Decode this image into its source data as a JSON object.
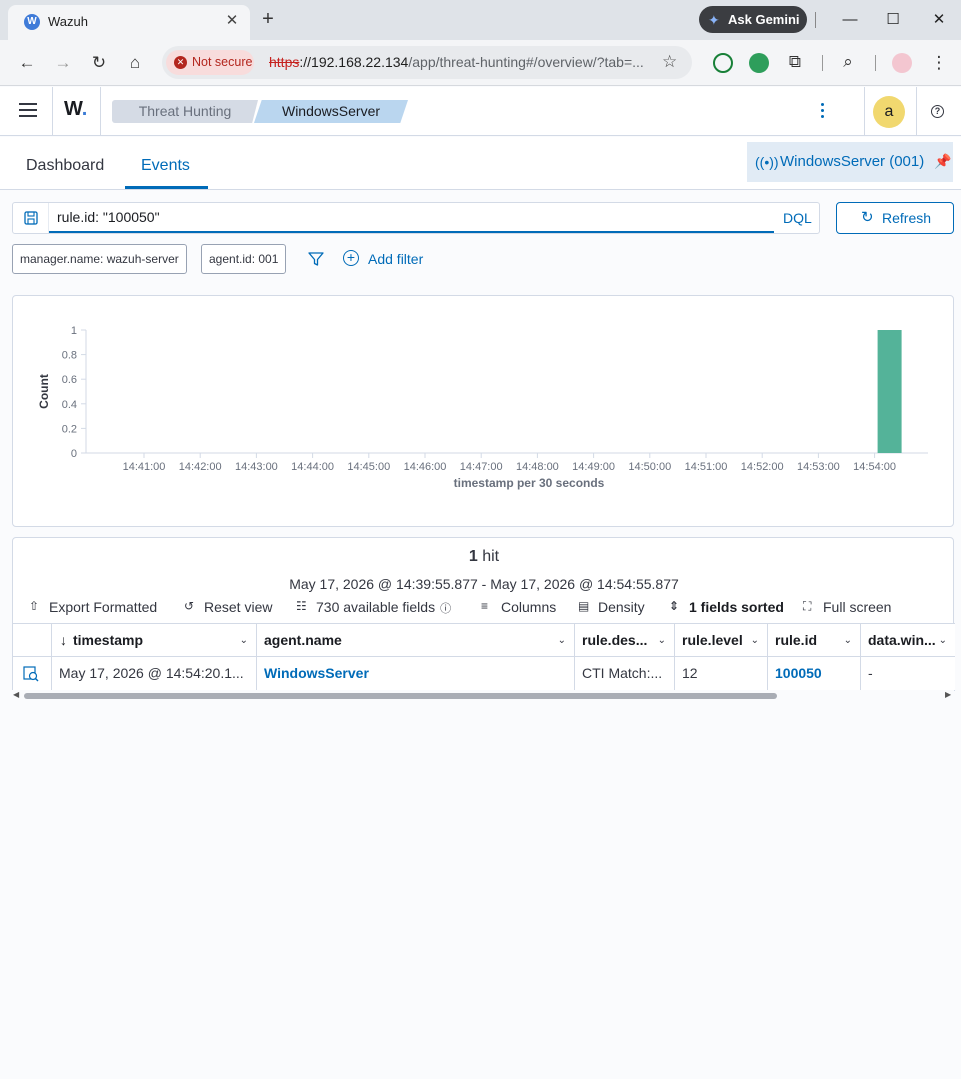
{
  "browser": {
    "tab_title": "Wazuh",
    "tab_favicon": "W",
    "gemini_label": "Ask Gemini",
    "security_label": "Not secure",
    "url_proto": "https",
    "url_host": "://192.168.22.134",
    "url_path": "/app/threat-hunting#/overview/?tab=..."
  },
  "header": {
    "logo": "W",
    "breadcrumbs": [
      "Threat Hunting",
      "WindowsServer"
    ],
    "avatar_initial": "a",
    "help_glyph": "?"
  },
  "tabs": {
    "items": [
      "Dashboard",
      "Events"
    ],
    "active": "Events",
    "pinned_agent": "WindowsServer (001)"
  },
  "query": {
    "value": "rule.id: \"100050\"",
    "language": "DQL",
    "refresh_label": "Refresh"
  },
  "filters": {
    "pills": [
      "manager.name: wazuh-server",
      "agent.id: 001"
    ],
    "add_label": "Add filter"
  },
  "chart_data": {
    "type": "bar",
    "x_labels": [
      "14:41:00",
      "14:42:00",
      "14:43:00",
      "14:44:00",
      "14:45:00",
      "14:46:00",
      "14:47:00",
      "14:48:00",
      "14:49:00",
      "14:50:00",
      "14:51:00",
      "14:52:00",
      "14:53:00",
      "14:54:00"
    ],
    "y_ticks": [
      "1",
      "0.8",
      "0.6",
      "0.4",
      "0.2",
      "0"
    ],
    "ylim": [
      0,
      1
    ],
    "bars": [
      {
        "x": "14:54:00",
        "value": 1
      }
    ],
    "xlabel": "timestamp per 30 seconds",
    "ylabel": "Count",
    "bar_color": "#54b399"
  },
  "results": {
    "hits_count": "1",
    "hits_word": "hit",
    "date_range": "May 17, 2026 @ 14:39:55.877 - May 17, 2026 @ 14:54:55.877",
    "toolbar": {
      "export": "Export Formatted",
      "reset": "Reset view",
      "fields": "730 available fields",
      "columns": "Columns",
      "density": "Density",
      "sorted": "1 fields sorted",
      "fullscreen": "Full screen"
    },
    "columns": [
      "timestamp",
      "agent.name",
      "rule.des...",
      "rule.level",
      "rule.id",
      "data.win..."
    ],
    "rows": [
      {
        "timestamp": "May 17, 2026 @ 14:54:20.1...",
        "agent_name": "WindowsServer",
        "rule_description": "CTI Match:...",
        "rule_level": "12",
        "rule_id": "100050",
        "data_win": "-"
      }
    ]
  }
}
